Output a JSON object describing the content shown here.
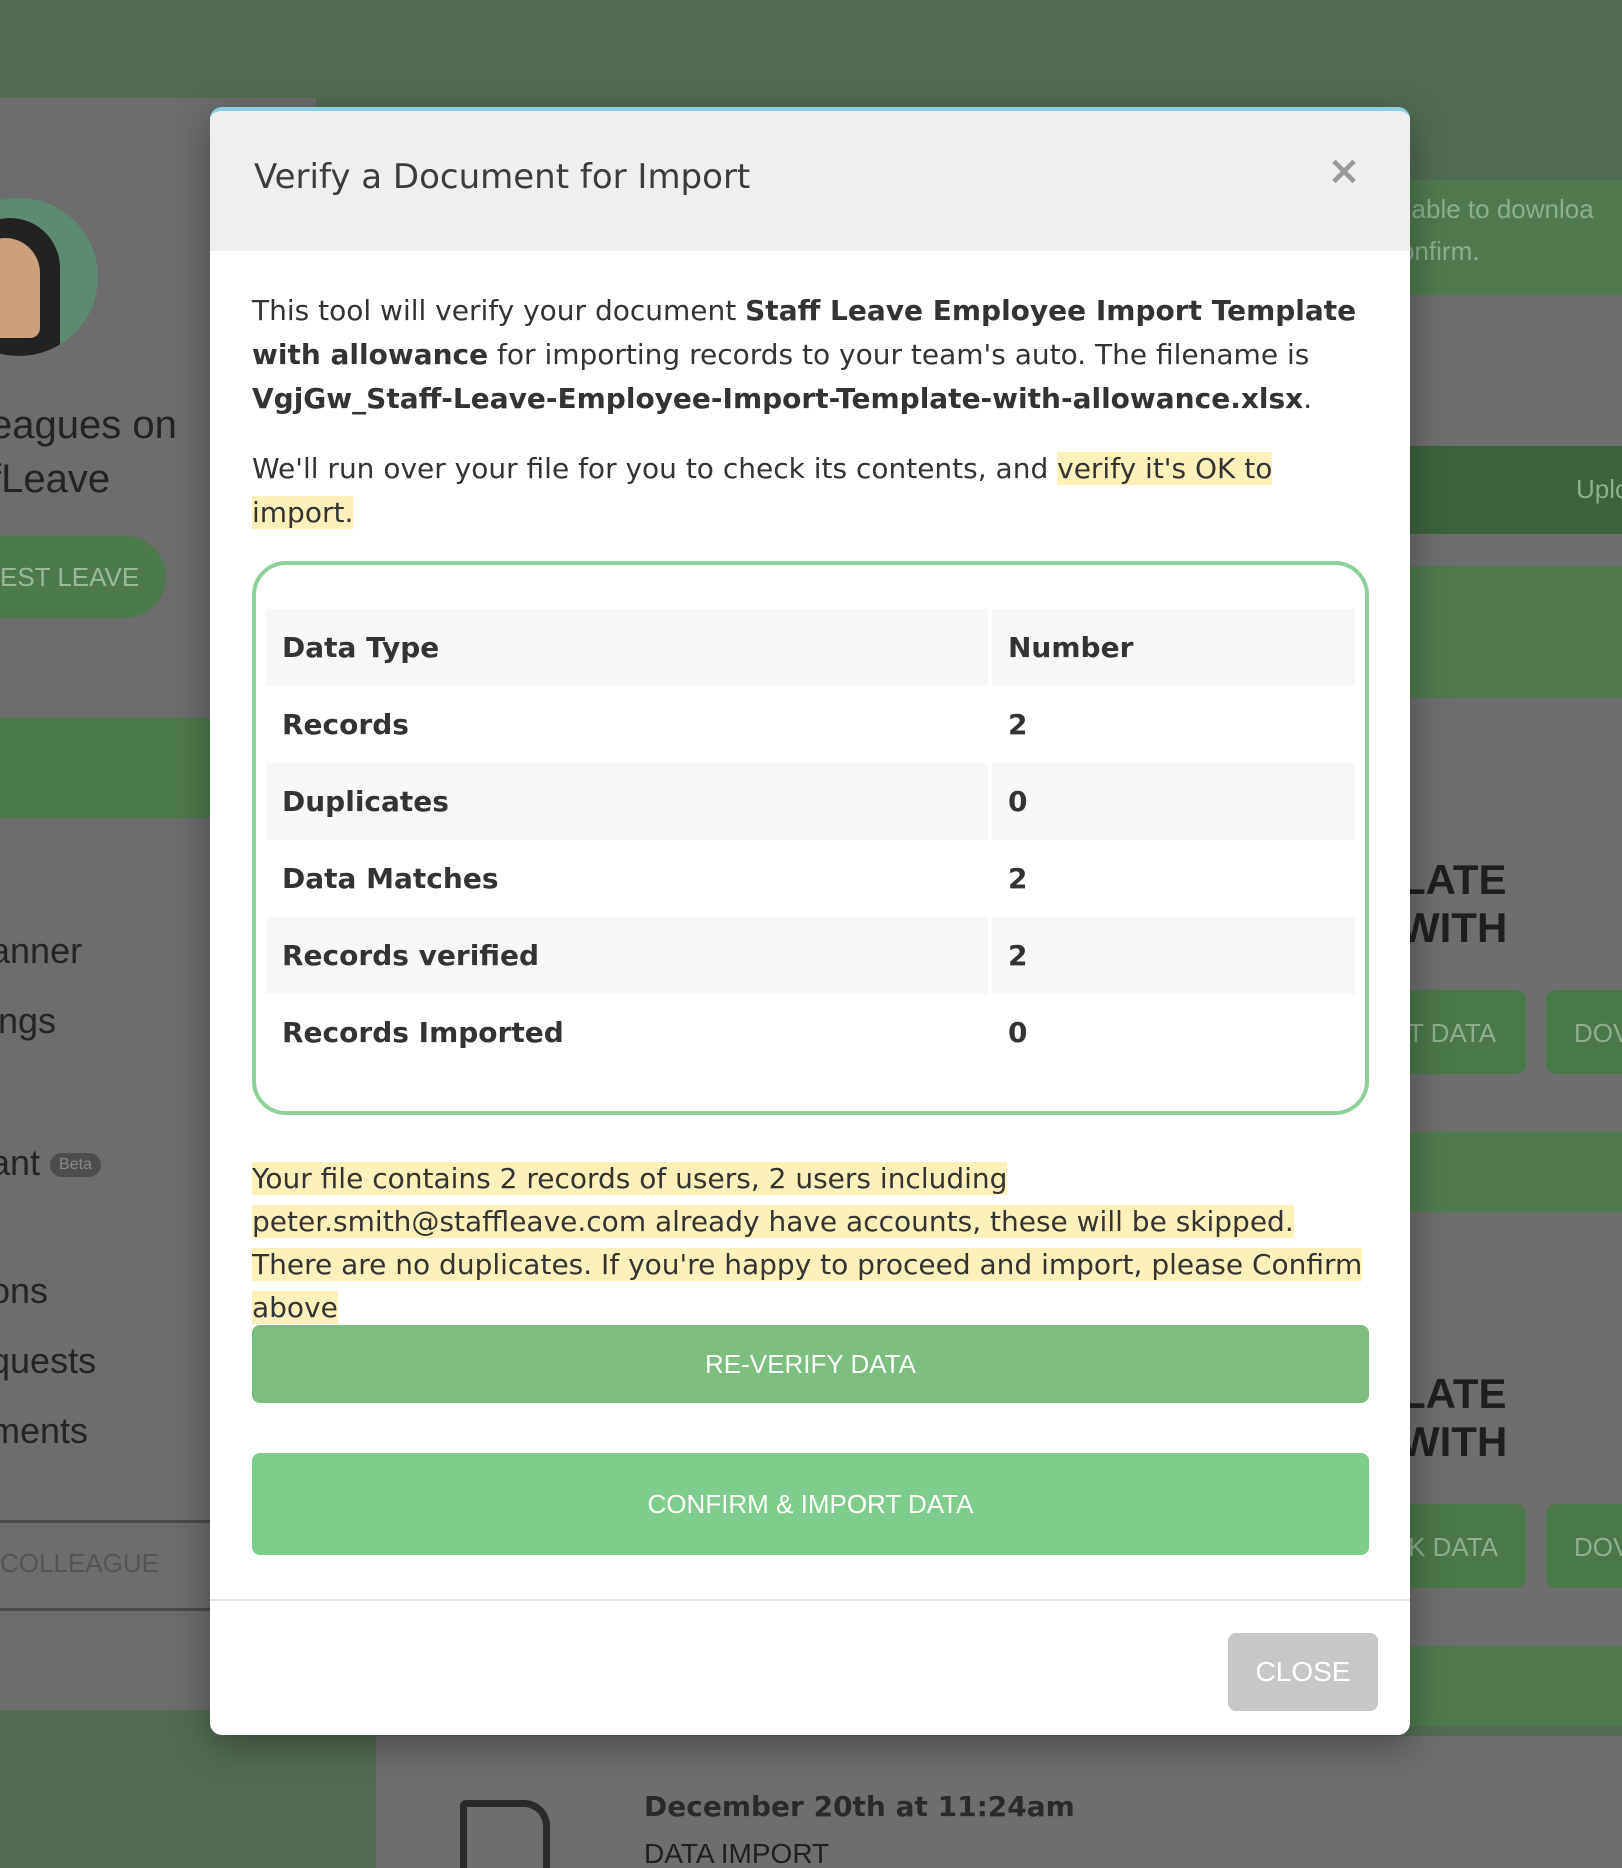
{
  "background": {
    "heading_line1": "eagues on",
    "heading_line2": "fLeave",
    "request_leave": "EST LEAVE",
    "nav_items": [
      "anner",
      "ings",
      "ant",
      "ons",
      "quests",
      "ments"
    ],
    "beta_badge": "Beta",
    "colleague_button": "COLLEAGUE",
    "right_text_line1": "ilable to downloa",
    "right_text_line2": "onfirm.",
    "upload_label": "Uplo",
    "template_heading_1": "LATE WITH",
    "template_heading_2": "LATE WITH",
    "data_button_1": "T DATA",
    "data_button_2": "K DATA",
    "download_label": "DOV",
    "activity_date": "December 20th at 11:24am",
    "activity_type": "DATA IMPORT"
  },
  "modal": {
    "title": "Verify a Document for Import",
    "close_icon": "×",
    "intro": {
      "prefix": "This tool will verify your document ",
      "document_name": "Staff Leave Employee Import Template with allowance",
      "middle": " for importing records to your team's auto. The filename is ",
      "filename": "VgjGw_Staff-Leave-Employee-Import-Template-with-allowance.xlsx",
      "suffix": "."
    },
    "intro2": {
      "prefix": "We'll run over your file for you to check its contents, and ",
      "highlight": "verify it's OK to import."
    },
    "table": {
      "headers": [
        "Data Type",
        "Number"
      ],
      "rows": [
        {
          "label": "Records",
          "value": "2"
        },
        {
          "label": "Duplicates",
          "value": "0"
        },
        {
          "label": "Data Matches",
          "value": "2"
        },
        {
          "label": "Records verified",
          "value": "2"
        },
        {
          "label": "Records Imported",
          "value": "0"
        }
      ]
    },
    "summary": "Your file contains 2 records of users, 2 users including peter.smith@staffleave.com already have accounts, these will be skipped. There are no duplicates. If you're happy to proceed and import, please Confirm above",
    "reverify_button": "RE-VERIFY DATA",
    "confirm_button": "CONFIRM & IMPORT DATA",
    "close_button": "CLOSE"
  },
  "colors": {
    "page_background": "#536b53",
    "reverify": "#7cbe7f",
    "confirm": "#7dcd8c",
    "highlight": "#fdf0b8",
    "table_border": "#8fd19a"
  }
}
